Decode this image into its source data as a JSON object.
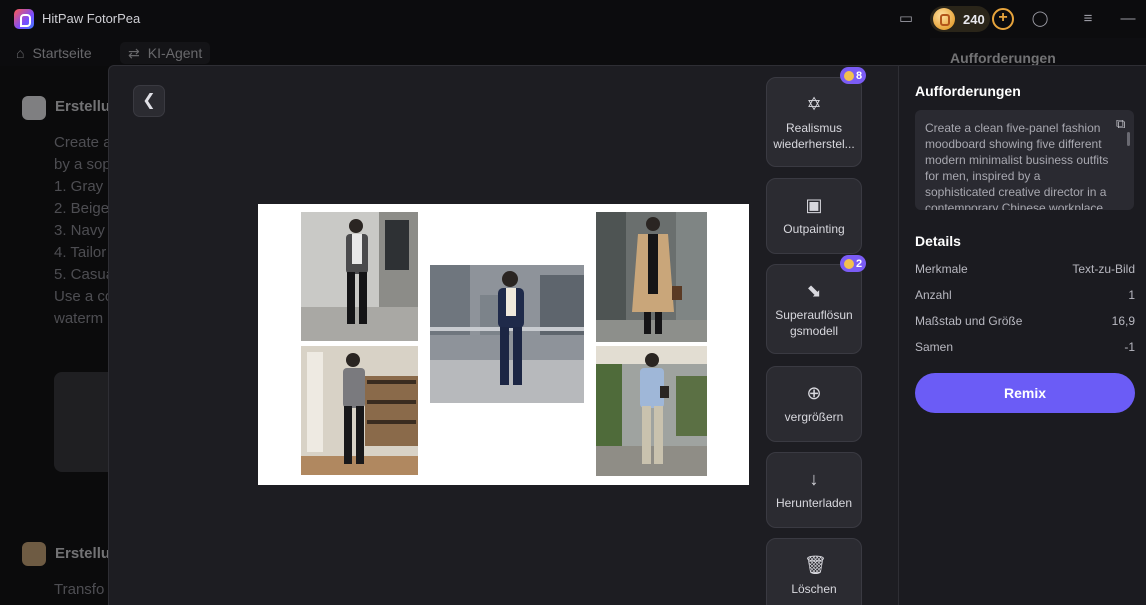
{
  "app": {
    "title": "HitPaw FotorPea",
    "credits": "240"
  },
  "toolbar": {
    "home_label": "Startseite",
    "agent_label": "KI-Agent"
  },
  "right_column": {
    "title": "Aufforderungen"
  },
  "background_chat": {
    "msg1_title": "Erstellu",
    "msg1_lines": [
      "Create a",
      "by a sop",
      "1. Gray",
      "2. Beige",
      "3. Navy",
      "4. Tailor",
      "5. Casua",
      "Use a co",
      "waterm"
    ],
    "msg2_title": "Erstellu",
    "msg2_line": "Transfo"
  },
  "actions": {
    "realismus": {
      "label": "Realismus wiederherstel...",
      "cost": "8"
    },
    "outpainting": {
      "label": "Outpainting"
    },
    "superres": {
      "label": "Superauflösun gsmodell",
      "cost": "2"
    },
    "zoom": {
      "label": "vergrößern"
    },
    "download": {
      "label": "Herunterladen"
    },
    "delete": {
      "label": "Löschen"
    }
  },
  "panel": {
    "prompts_title": "Aufforderungen",
    "prompt_text": "Create a clean five-panel fashion moodboard showing five different modern minimalist business outfits for men, inspired by a sophisticated creative director in a contemporary Chinese workplace",
    "details_title": "Details",
    "details": [
      {
        "key": "Merkmale",
        "value": "Text-zu-Bild"
      },
      {
        "key": "Anzahl",
        "value": "1"
      },
      {
        "key": "Maßstab und Größe",
        "value": "16,9"
      },
      {
        "key": "Samen",
        "value": "-1"
      }
    ],
    "remix_label": "Remix"
  },
  "colors": {
    "accent": "#6b5cf6",
    "badge": "#7b5cf5",
    "coin": "#e8a53b"
  }
}
